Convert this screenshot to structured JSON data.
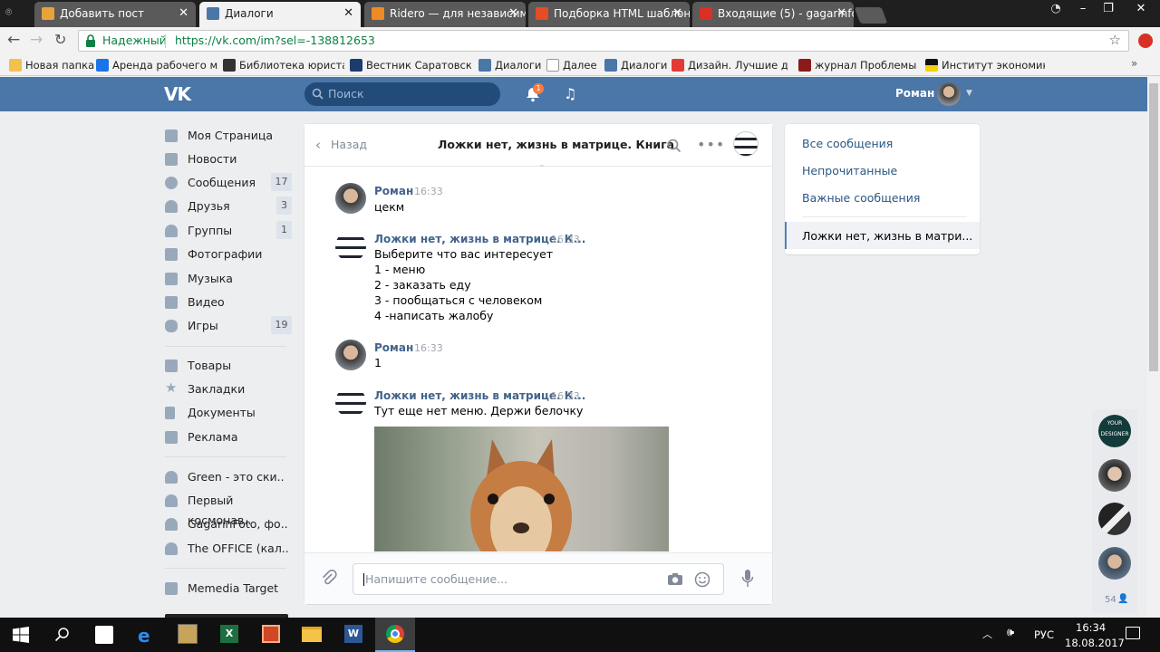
{
  "browser": {
    "tabs": [
      {
        "title": "Добавить пост",
        "color": "#e8a33a"
      },
      {
        "title": "Диалоги",
        "color": "#4a76a8"
      },
      {
        "title": "Ridero — для независим",
        "color": "#f08a24"
      },
      {
        "title": "Подборка HTML шаблон",
        "color": "#e44d26"
      },
      {
        "title": "Входящие (5) - gagarinfo",
        "color": "#d93025"
      }
    ],
    "security_label": "Надежный",
    "url": "https://vk.com/im?sel=-138812653",
    "bookmarks": [
      "Новая папка",
      "Аренда рабочего ме",
      "Библиотека юриста -",
      "Вестник Саратовской",
      "Диалоги",
      "Далее",
      "Диалоги",
      "Дизайн. Лучшие диз",
      "журнал Проблемы м",
      "Институт экономики"
    ]
  },
  "header": {
    "logo": "VK",
    "search_placeholder": "Поиск",
    "notifications_count": "1",
    "user_name": "Роман"
  },
  "sidebar": {
    "items": [
      {
        "label": "Моя Страница",
        "count": ""
      },
      {
        "label": "Новости",
        "count": ""
      },
      {
        "label": "Сообщения",
        "count": "17"
      },
      {
        "label": "Друзья",
        "count": "3"
      },
      {
        "label": "Группы",
        "count": "1"
      },
      {
        "label": "Фотографии",
        "count": ""
      },
      {
        "label": "Музыка",
        "count": ""
      },
      {
        "label": "Видео",
        "count": ""
      },
      {
        "label": "Игры",
        "count": "19"
      }
    ],
    "items2": [
      "Товары",
      "Закладки",
      "Документы",
      "Реклама"
    ],
    "groups": [
      "Green - это ски..",
      "Первый космонав..",
      "GagarinFoto, фо..",
      "The OFFICE (кал.."
    ],
    "apps": [
      "Memedia Target"
    ]
  },
  "chat": {
    "back_label": "Назад",
    "title": "Ложки нет, жизнь в матрице. Книга",
    "messages": [
      {
        "author": "Роман",
        "time": "16:33",
        "text": [
          "цекм"
        ]
      },
      {
        "author": "Ложки нет, жизнь в матрице. К...",
        "time": "16:33",
        "text": [
          "Выберите что вас интересует",
          "1 - меню",
          "2 - заказать еду",
          "3 - пообщаться с человеком",
          "4 -написать жалобу"
        ]
      },
      {
        "author": "Роман",
        "time": "16:33",
        "text": [
          "1"
        ]
      },
      {
        "author": "Ложки нет, жизнь в матрице. К...",
        "time": "16:33",
        "text": [
          "Тут еще нет меню. Держи белочку"
        ]
      }
    ],
    "input_placeholder": "Напишите сообщение..."
  },
  "right_panel": {
    "links": [
      "Все сообщения",
      "Непрочитанные",
      "Важные сообщения"
    ],
    "active_dialog": "Ложки нет, жизнь в матри..."
  },
  "online": {
    "count": "54"
  },
  "taskbar": {
    "lang": "РУС",
    "time": "16:34",
    "date": "18.08.2017"
  }
}
